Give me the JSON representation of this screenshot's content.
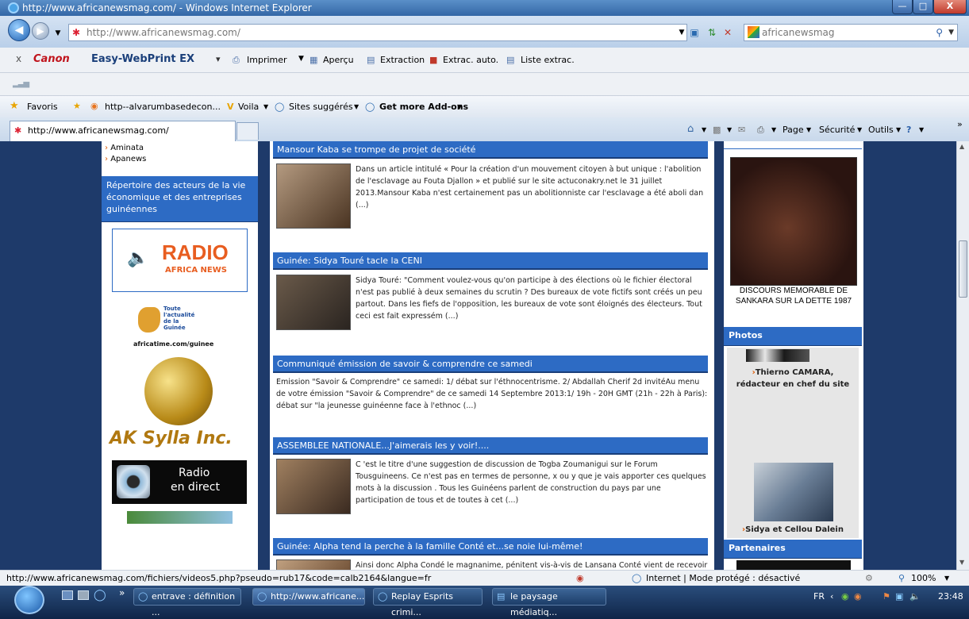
{
  "window": {
    "title": "http://www.africanewsmag.com/ - Windows Internet Explorer",
    "controls": [
      "—",
      "□",
      "X"
    ]
  },
  "nav": {
    "address": "http://www.africanewsmag.com/",
    "address_domain": "africanewsmag.com",
    "search_text": "africanewsmag"
  },
  "canon_toolbar": {
    "close": "x",
    "brand": "Canon",
    "product": "Easy-WebPrint EX",
    "print": "Imprimer",
    "preview": "Aperçu",
    "extraction": "Extraction",
    "extrac_auto": "Extrac. auto.",
    "liste": "Liste extrac."
  },
  "favorites_bar": {
    "favoris": "Favoris",
    "link1": "http--alvarumbasedecon...",
    "voila": "Voila",
    "suggested": "Sites suggérés",
    "addons": "Get more Add-ons"
  },
  "tab": {
    "label": "http://www.africanewsmag.com/"
  },
  "commandbar": {
    "page": "Page",
    "security": "Sécurité",
    "tools": "Outils"
  },
  "left": {
    "links": [
      "Aminata",
      "Apanews"
    ],
    "repertoire": "Répertoire des acteurs de la vie économique et des entreprises guinéennes",
    "radio_logo": "RADIO",
    "radio_sub": "AFRICA NEWS",
    "africatime_lines": [
      "Toute",
      "l'actualité",
      "de la",
      "Guinée"
    ],
    "africatime_url": "africatime.com/guinee",
    "aksylla": "AK Sylla Inc.",
    "radio_direct": "Radio",
    "radio_direct2": "en direct"
  },
  "articles": [
    {
      "title": "Mansour Kaba se trompe de projet de société",
      "text": "Dans un article intitulé « Pour la création d'un mouvement citoyen à but unique : l'abolition de l'esclavage au Fouta Djallon » et publié sur le site actuconakry.net le 31 juillet 2013.Mansour Kaba n'est certainement pas un abolitionniste car l'esclavage a été aboli dan (...)"
    },
    {
      "title": "Guinée: Sidya Touré tacle la CENI",
      "text": "Sidya Touré: \"Comment voulez-vous qu'on participe à des élections où le fichier électoral n'est pas publié à deux semaines du scrutin ? Des bureaux de vote fictifs sont créés un peu partout. Dans les fiefs de l'opposition, les bureaux de vote sont éloignés des électeurs. Tout ceci est fait expressém (...)"
    },
    {
      "title": "Communiqué émission de savoir & comprendre ce samedi",
      "text": "Emission \"Savoir & Comprendre\" ce samedi: 1/ débat sur l'éthnocentrisme. 2/ Abdallah Cherif 2d invitéAu menu de votre émission \"Savoir & Comprendre\" de ce samedi 14 Septembre 2013:1/ 19h - 20H GMT (21h - 22h à Paris): débat sur \"la jeunesse guinéenne face à l'ethnoc (...)"
    },
    {
      "title": "ASSEMBLEE NATIONALE...J'aimerais les y voir!....",
      "text": "C 'est le titre d'une suggestion de discussion de Togba Zoumanigui sur le Forum Tousguineens. Ce n'est pas en termes de personne, x ou y que je vais apporter ces quelques mots à la discussion . Tous les Guinéens parlent de construction du pays par une participation de tous et de toutes à cet (...)"
    },
    {
      "title": "Guinée: Alpha tend la perche à la famille Conté et...se noie lui-même!",
      "text": "Ainsi donc Alpha Condé le magnanime, pénitent vis-à-vis de Lansana Conté vient de recevoir le"
    }
  ],
  "right": {
    "sankara_caption": "DISCOURS MEMORABLE DE SANKARA SUR LA DETTE 1987",
    "photos_hdr": "Photos",
    "photo1_caption": "Thierno CAMARA, rédacteur en chef du site",
    "photo2_caption": "Sidya et Cellou Dalein",
    "partners_hdr": "Partenaires"
  },
  "status": {
    "url": "http://www.africanewsmag.com/fichiers/videos5.php?pseudo=rub17&code=calb2164&langue=fr",
    "zone": "Internet | Mode protégé : désactivé",
    "zoom": "100%"
  },
  "taskbar": {
    "tasks": [
      "entrave : définition ...",
      "http://www.africane...",
      "Replay Esprits crimi...",
      "le paysage médiatiq..."
    ],
    "lang": "FR",
    "time": "23:48"
  },
  "colors": {
    "ie_blue": "#2d6bc4",
    "page_bg": "#1e3a6a"
  }
}
